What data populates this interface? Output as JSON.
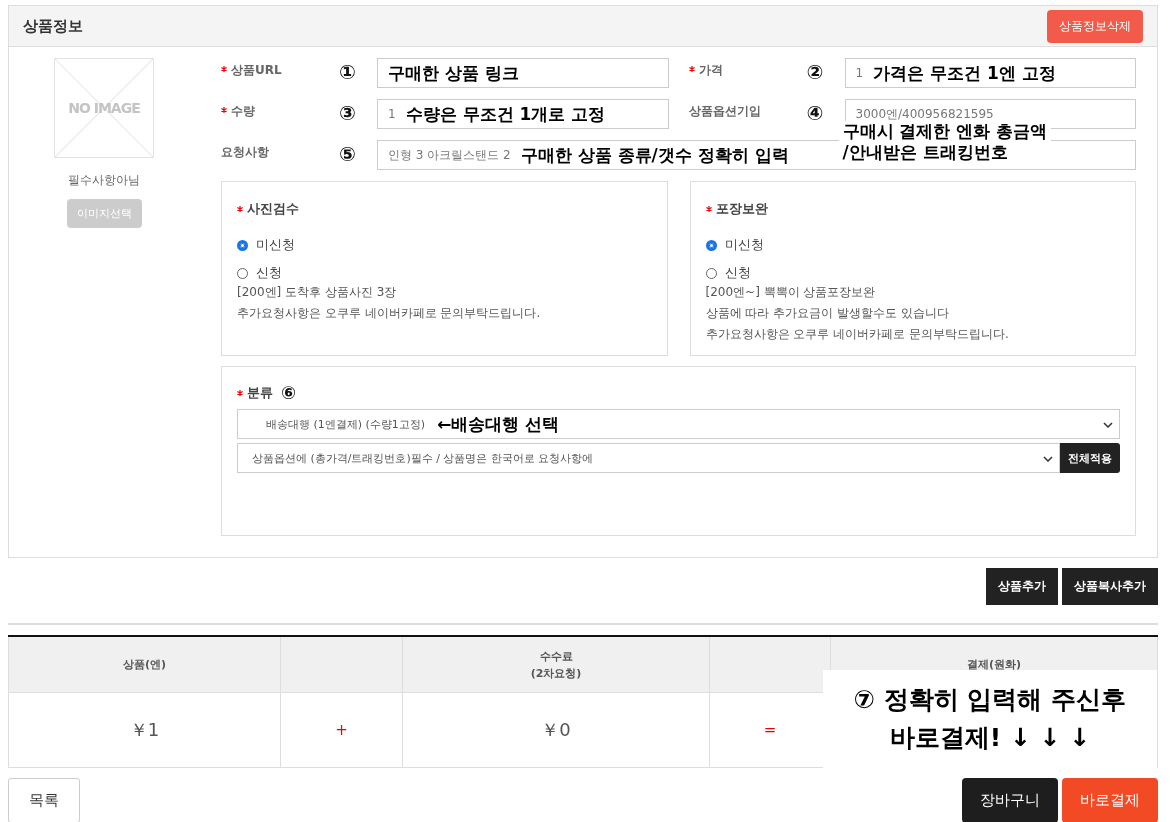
{
  "panel": {
    "title": "상품정보",
    "delete_button": "상품정보삭제"
  },
  "image": {
    "placeholder": "NO IMAGE",
    "note": "필수사항아님",
    "button": "이미지선택"
  },
  "fields": [
    {
      "label": "상품URL",
      "required": true,
      "marker": "①",
      "annotation": "구매한 상품 링크"
    },
    {
      "label": "가격",
      "required": true,
      "value": "1",
      "marker": "②",
      "annotation": "가격은 무조건 1엔 고정"
    },
    {
      "label": "수량",
      "required": true,
      "value": "1",
      "marker": "③",
      "annotation": "수량은 무조건 1개로 고정"
    },
    {
      "label": "상품옵션기입",
      "required": false,
      "value": "3000엔/400956821595",
      "marker": "④"
    },
    {
      "label": "요청사항",
      "required": false,
      "value": "인형 3 아크릴스탠드 2",
      "marker": "⑤",
      "annotation": "구매한 상품 종류/갯수 정확히 입력"
    }
  ],
  "option_note": [
    "구매시 결제한 엔화 총금액",
    "/안내받은 트래킹번호"
  ],
  "options": [
    {
      "title": "사진검수",
      "required": true,
      "radios": [
        {
          "label": "미신청",
          "selected": true
        },
        {
          "label": "신청",
          "selected": false
        }
      ],
      "notes": [
        "[200엔] 도착후 상품사진 3장",
        "추가요청사항은 오쿠루 네이버카페로 문의부탁드립니다."
      ]
    },
    {
      "title": "포장보완",
      "required": true,
      "radios": [
        {
          "label": "미신청",
          "selected": true
        },
        {
          "label": "신청",
          "selected": false
        }
      ],
      "notes": [
        "[200엔~] 뽁뽁이 상품포장보완",
        "상품에 따라 추가요금이 발생할수도 있습니다",
        "추가요청사항은 오쿠루 네이버카페로 문의부탁드립니다."
      ]
    }
  ],
  "category": {
    "label": "분류",
    "required": true,
    "marker": "⑥",
    "select_1": "배송대행 (1엔결제) (수량1고정)",
    "select_1_annotation": "←배송대행 선택",
    "select_2": "상품옵션에 (총가격/트래킹번호)필수 / 상품명은 한국어로 요청사항에",
    "apply_button": "전체적용"
  },
  "add_buttons": [
    "상품추가",
    "상품복사추가"
  ],
  "summary": {
    "columns": [
      "상품(엔)",
      "수수료\n(2차요청)",
      "결제(원화)"
    ],
    "values": [
      "￥1",
      "￥0"
    ],
    "operators": [
      "+",
      "="
    ]
  },
  "pay_note": [
    "⑦ 정확히 입력해 주신후",
    "바로결제! ↓ ↓ ↓"
  ],
  "footer": {
    "list_button": "목록",
    "cart_button": "장바구니",
    "buy_button": "바로결제"
  }
}
